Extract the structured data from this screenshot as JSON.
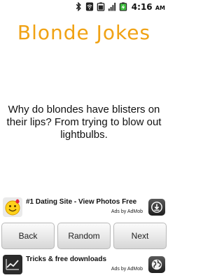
{
  "status_bar": {
    "time": "4:16",
    "ampm": "AM",
    "icons": [
      "bluetooth-icon",
      "wifi-icon",
      "battery-icon",
      "signal-icon",
      "charging-icon"
    ]
  },
  "app": {
    "title": "Blonde Jokes",
    "accent_color": "#f0a214"
  },
  "joke": {
    "text": "Why do blondes have blisters on their lips?  From trying to blow out lightbulbs."
  },
  "ads": {
    "top": {
      "text": "#1 Dating Site - View Photos Free",
      "attribution": "Ads by AdMob",
      "icon": "smiley-icon",
      "action_icon": "download-icon"
    },
    "bottom": {
      "text": "Tricks & free downloads",
      "attribution": "Ads by AdMob",
      "icon": "chart-icon",
      "action_icon": "globe-icon"
    }
  },
  "navigation": {
    "back_label": "Back",
    "random_label": "Random",
    "next_label": "Next"
  }
}
